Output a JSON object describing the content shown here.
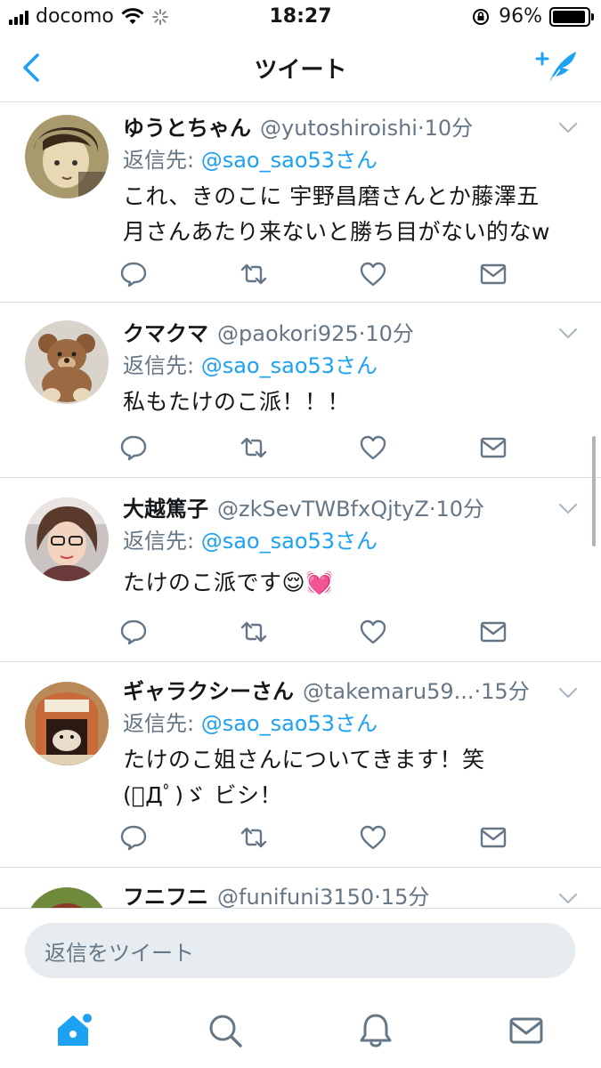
{
  "status_bar": {
    "carrier": "docomo",
    "time": "18:27",
    "battery": "96%",
    "battery_level": 0.96
  },
  "nav": {
    "title": "ツイート"
  },
  "tweets": [
    {
      "name": "ゆうとちゃん",
      "handle": "@yutoshiroishi",
      "sep": " · ",
      "time": "10分",
      "reply_label": "返信先: ",
      "reply_mention": "@sao_sao53さん",
      "lines": [
        "これ、きのこに 宇野昌磨さんとか藤澤五",
        "月さんあたり来ないと勝ち目がない的なw"
      ]
    },
    {
      "name": "クマクマ",
      "handle": "@paokori925",
      "sep": " · ",
      "time": "10分",
      "reply_label": "返信先: ",
      "reply_mention": "@sao_sao53さん",
      "lines": [
        "私もたけのこ派！！！"
      ]
    },
    {
      "name": "大越篤子",
      "handle": "@zkSevTWBfxQjtyZ",
      "sep": " · ",
      "time": "10分",
      "reply_label": "返信先: ",
      "reply_mention": "@sao_sao53さん",
      "lines": [
        "たけのこ派です😌💓"
      ]
    },
    {
      "name": "ギャラクシーさん",
      "handle": "@takemaru59...",
      "sep": " · ",
      "time": "15分",
      "reply_label": "返信先: ",
      "reply_mention": "@sao_sao53さん",
      "lines": [
        "たけのこ姐さんについてきます！笑",
        "(ﾟДﾟ)ゞ ビシ！"
      ]
    },
    {
      "name": "フニフニ",
      "handle": "@funifuni3150",
      "sep": " · ",
      "time": "15分"
    }
  ],
  "reply_bar": {
    "placeholder": "返信をツイート"
  },
  "colors": {
    "accent": "#1da1f2",
    "secondary_text": "#657786",
    "divider": "#d9dde0",
    "input_bg": "#e6ecf0"
  },
  "icons": [
    "back-chevron-icon",
    "compose-tweet-icon",
    "reply-icon",
    "retweet-icon",
    "like-icon",
    "dm-icon",
    "caret-down-icon",
    "home-icon",
    "search-icon",
    "notifications-icon",
    "messages-icon"
  ]
}
